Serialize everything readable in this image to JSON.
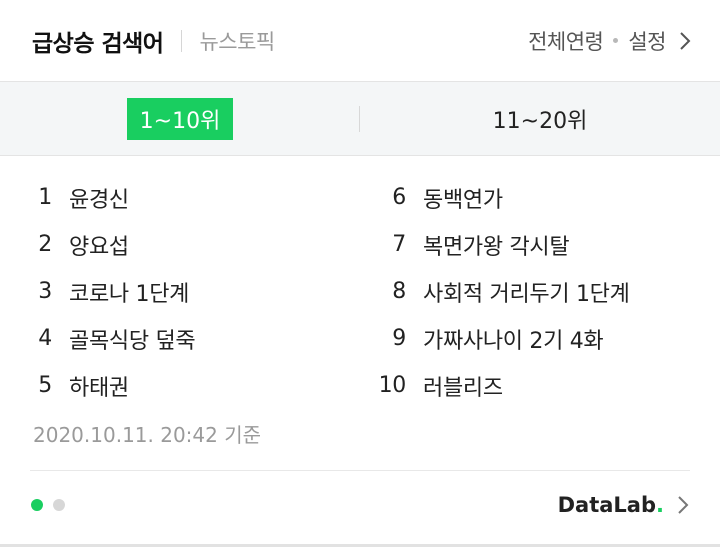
{
  "header": {
    "title": "급상승 검색어",
    "newstopic": "뉴스토픽",
    "age_filter": "전체연령",
    "settings": "설정"
  },
  "tabs": [
    {
      "label": "1~10위",
      "active": true
    },
    {
      "label": "11~20위",
      "active": false
    }
  ],
  "ranking": {
    "left": [
      {
        "rank": "1",
        "keyword": "윤경신"
      },
      {
        "rank": "2",
        "keyword": "양요섭"
      },
      {
        "rank": "3",
        "keyword": "코로나 1단계"
      },
      {
        "rank": "4",
        "keyword": "골목식당 덮죽"
      },
      {
        "rank": "5",
        "keyword": "하태권"
      }
    ],
    "right": [
      {
        "rank": "6",
        "keyword": "동백연가"
      },
      {
        "rank": "7",
        "keyword": "복면가왕 각시탈"
      },
      {
        "rank": "8",
        "keyword": "사회적 거리두기 1단계"
      },
      {
        "rank": "9",
        "keyword": "가짜사나이 2기 4화"
      },
      {
        "rank": "10",
        "keyword": "러블리즈"
      }
    ]
  },
  "timestamp": "2020.10.11. 20:42 기준",
  "footer": {
    "datalab_text": "DataLab",
    "datalab_dot": ".",
    "pager_active_index": 1,
    "pager_total": 2
  },
  "colors": {
    "accent": "#19ce60"
  }
}
